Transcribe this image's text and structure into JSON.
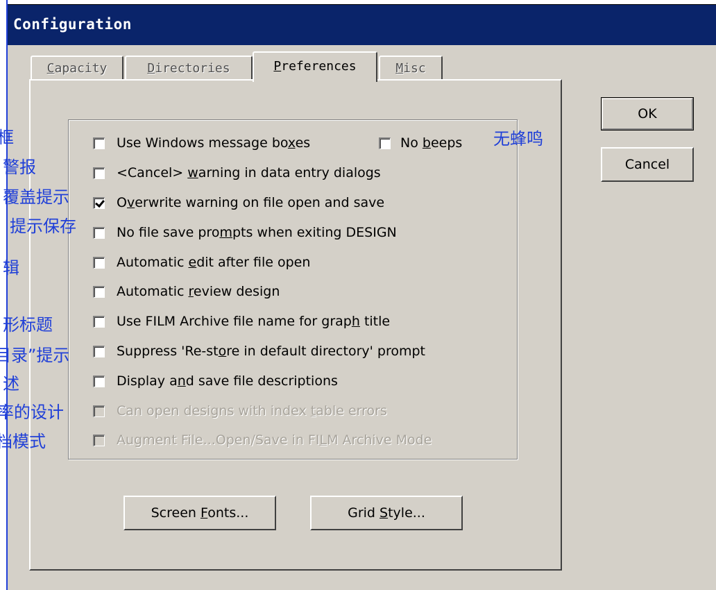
{
  "window": {
    "title": "Configuration"
  },
  "tabs": [
    {
      "label_pre": "",
      "accel": "C",
      "label_post": "apacity"
    },
    {
      "label_pre": "",
      "accel": "D",
      "label_post": "irectories"
    },
    {
      "label_pre": "",
      "accel": "P",
      "label_post": "references"
    },
    {
      "label_pre": "",
      "accel": "M",
      "label_post": "isc"
    }
  ],
  "options": [
    {
      "pre": "Use Windows message bo",
      "accel": "x",
      "post": "es",
      "checked": false
    },
    {
      "pre": "No ",
      "accel": "b",
      "post": "eeps",
      "checked": false
    },
    {
      "pre": "<Cancel> ",
      "accel": "w",
      "post": "arning in data entry dialogs",
      "checked": false
    },
    {
      "pre": "O",
      "accel": "v",
      "post": "erwrite warning on file open and save",
      "checked": true
    },
    {
      "pre": "No file save pro",
      "accel": "m",
      "post": "pts when exiting DESIGN",
      "checked": false
    },
    {
      "pre": "Automatic ",
      "accel": "e",
      "post": "dit after file open",
      "checked": false
    },
    {
      "pre": "Automatic ",
      "accel": "r",
      "post": "eview design",
      "checked": false
    },
    {
      "pre": "Use FILM Archive file name for grap",
      "accel": "h",
      "post": " title",
      "checked": false
    },
    {
      "pre": "Suppress 'Re-st",
      "accel": "o",
      "post": "re in default directory' prompt",
      "checked": false
    },
    {
      "pre": "Display a",
      "accel": "n",
      "post": "d save file descriptions",
      "checked": false
    },
    {
      "pre": "Can open designs with index ",
      "accel": "t",
      "post": "able errors",
      "checked": false,
      "disabled": true
    },
    {
      "pre": "Augment File...Open/Save in FI",
      "accel": "L",
      "post": "M Archive Mode",
      "checked": false,
      "disabled": true
    }
  ],
  "buttons": {
    "ok": "OK",
    "cancel": "Cancel",
    "screen_fonts_pre": "Screen ",
    "screen_fonts_accel": "F",
    "screen_fonts_post": "onts...",
    "grid_style_pre": "Grid ",
    "grid_style_accel": "S",
    "grid_style_post": "tyle..."
  },
  "annotations": {
    "no_beeps": "无蜂鸣",
    "row1": "框",
    "row2": "警报",
    "row3": "覆盖提示",
    "row4": "提示保存",
    "row5": "辑",
    "row7": "形标题",
    "row8": "目录”提示",
    "row9": "述",
    "row10": "率的设计",
    "row11": "档模式"
  },
  "colors": {
    "titlebar": "#0a246a",
    "face": "#d4d0c8",
    "annotation": "#1f3fd8"
  }
}
